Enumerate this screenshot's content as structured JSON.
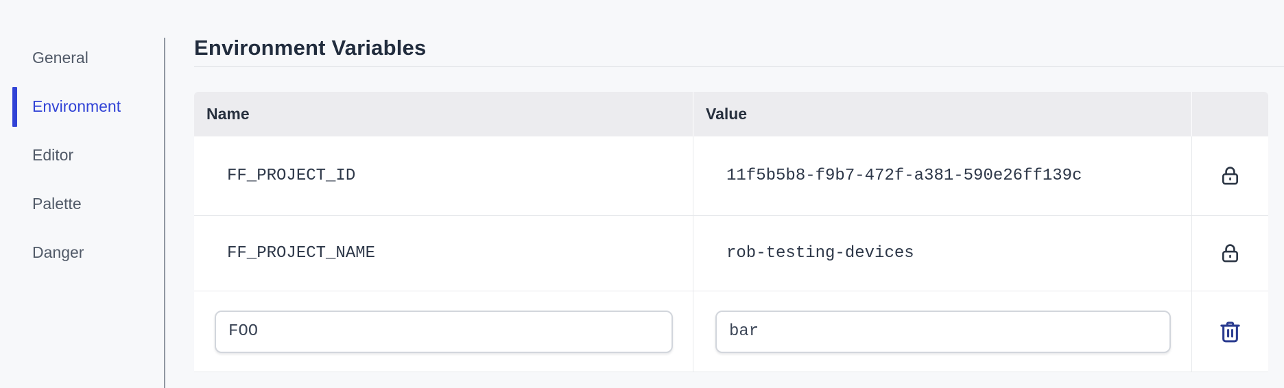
{
  "sidebar": {
    "items": [
      {
        "label": "General",
        "active": false
      },
      {
        "label": "Environment",
        "active": true
      },
      {
        "label": "Editor",
        "active": false
      },
      {
        "label": "Palette",
        "active": false
      },
      {
        "label": "Danger",
        "active": false
      }
    ]
  },
  "main": {
    "title": "Environment Variables",
    "table": {
      "columns": {
        "name": "Name",
        "value": "Value"
      },
      "rows": [
        {
          "name": "FF_PROJECT_ID",
          "value": "11f5b5b8-f9b7-472f-a381-590e26ff139c",
          "locked": true
        },
        {
          "name": "FF_PROJECT_NAME",
          "value": "rob-testing-devices",
          "locked": true
        }
      ],
      "editable_row": {
        "name_value": "FOO",
        "value_value": "bar"
      }
    }
  },
  "colors": {
    "accent_blue": "#3143d6",
    "trash_icon_navy": "#2b3c90",
    "lock_icon_slate": "#2b3544",
    "page_background": "#f7f8fa",
    "table_header_background": "#ececef",
    "title_text": "#212c3d"
  }
}
